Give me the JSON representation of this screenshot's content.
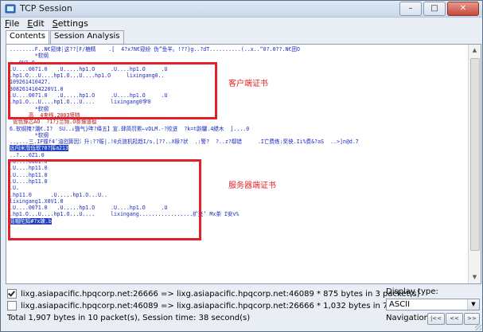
{
  "window": {
    "title": "TCP Session",
    "controls": {
      "minimize": "–",
      "maximize": "□",
      "close": "✕"
    }
  },
  "menu": [
    {
      "label": "File",
      "accel": "F"
    },
    {
      "label": "Edit",
      "accel": "E"
    },
    {
      "label": "Settings",
      "accel": "S"
    }
  ],
  "tabs": [
    "Contents",
    "Session Analysis"
  ],
  "content": {
    "lines": [
      {
        "t": "........F..N€窥律┆这??[F/樚精    .[  4?x?N€窥纷 伪”鱼羊。!??}g..?dT..........(..x..“0?.0??.N€团O",
        "c": "blue"
      },
      {
        "t": "        *软纲",
        "c": "blue"
      },
      {
        "t": "...0V1.0",
        "c": "blue"
      },
      {
        "t": ".U....0071.0   .U.....hp1.O     .U....hp1.O     .U",
        "c": "blue"
      },
      {
        "t": ".hp1.O...U....hp1.O...U....hp1.O     lixingang0..",
        "c": "blue"
      },
      {
        "t": "109261410427.",
        "c": "blue"
      },
      {
        "t": "3082614104220V1.0",
        "c": "blue"
      },
      {
        "t": ".U....0071.0   .U.....hp1.O     .U....hp1.O     .U",
        "c": "blue"
      },
      {
        "t": ".hp1.O...U....hp1.O...U....     lixingang0孛0",
        "c": "blue"
      },
      {
        "t": "        *软纲",
        "c": "blue"
      },
      {
        "t": "      高  4夹线.2003贤特",
        "c": "red"
      },
      {
        "t": " 管色豫芯AO  ?1?}兰频.O劵豫道檩",
        "c": "red"
      },
      {
        "t": "6.软纲掩?潮€.I?  SU..↓鹽气}哖?绛五】宣.肆简罚累←vDLM.-?賋迸  ?k=t鼩驪.4縹木  ]....0",
        "c": "blue"
      },
      {
        "t": "        *软纲",
        "c": "blue"
      },
      {
        "t": "..,...三.IF蝶f4’油迾箅因氵升:??赈|.!0贞誼机羟趋I/s.[??..X赎?状  .:警?  ?..z?郗错     .Ῑ亡费练:奖佒.Ii%费&?aS  ..>]n@d.7",
        "c": "blue"
      },
      {
        "t": "远闯米浌低软?0?挥a213",
        "c": "hl"
      },
      {
        "t": "..?...0Z1.0",
        "c": "blue"
      },
      {
        "t": ".U....0081.0",
        "c": "blue"
      },
      {
        "t": ".U....hp11.0",
        "c": "blue"
      },
      {
        "t": ".U....hp11.0",
        "c": "blue"
      },
      {
        "t": ".U....hp11.0",
        "c": "blue"
      },
      {
        "t": ".U.",
        "c": "blue"
      },
      {
        "t": ".hp11.0      .U.....hp1.O...U..",
        "c": "blue"
      },
      {
        "t": "lixingang1.X0V1.0",
        "c": "blue"
      },
      {
        "t": ".U....0071.0   .U.....hp1.O     .U....hp1.O     .U",
        "c": "blue"
      },
      {
        "t": ".hp1.O...U....hp1.O...U....     lixingang.................纩迕’ Mx茶 I安v%",
        "c": "blue"
      },
      {
        "t": "阅帽陀知#?x竦.b",
        "c": "hl"
      }
    ],
    "annotations": {
      "client_cert": "客户端证书",
      "server_cert": "服务器端证书"
    }
  },
  "streams": [
    {
      "checked": true,
      "label": "lixg.asiapacific.hpqcorp.net:26666 => lixg.asiapacific.hpqcorp.net:46089 * 875 bytes in 3 packet(s)"
    },
    {
      "checked": false,
      "label": "lixg.asiapacific.hpqcorp.net:46089 => lixg.asiapacific.hpqcorp.net:26666 * 1,032 bytes in 7 packet(s)"
    }
  ],
  "status": "Total 1,907 bytes in 10 packet(s), Session time: 38 second(s)",
  "display_type": {
    "label": "Display type:",
    "value": "ASCII"
  },
  "navigation": {
    "label": "Navigation:",
    "buttons": [
      "|<<",
      "<<",
      ">>",
      ">>|"
    ]
  }
}
